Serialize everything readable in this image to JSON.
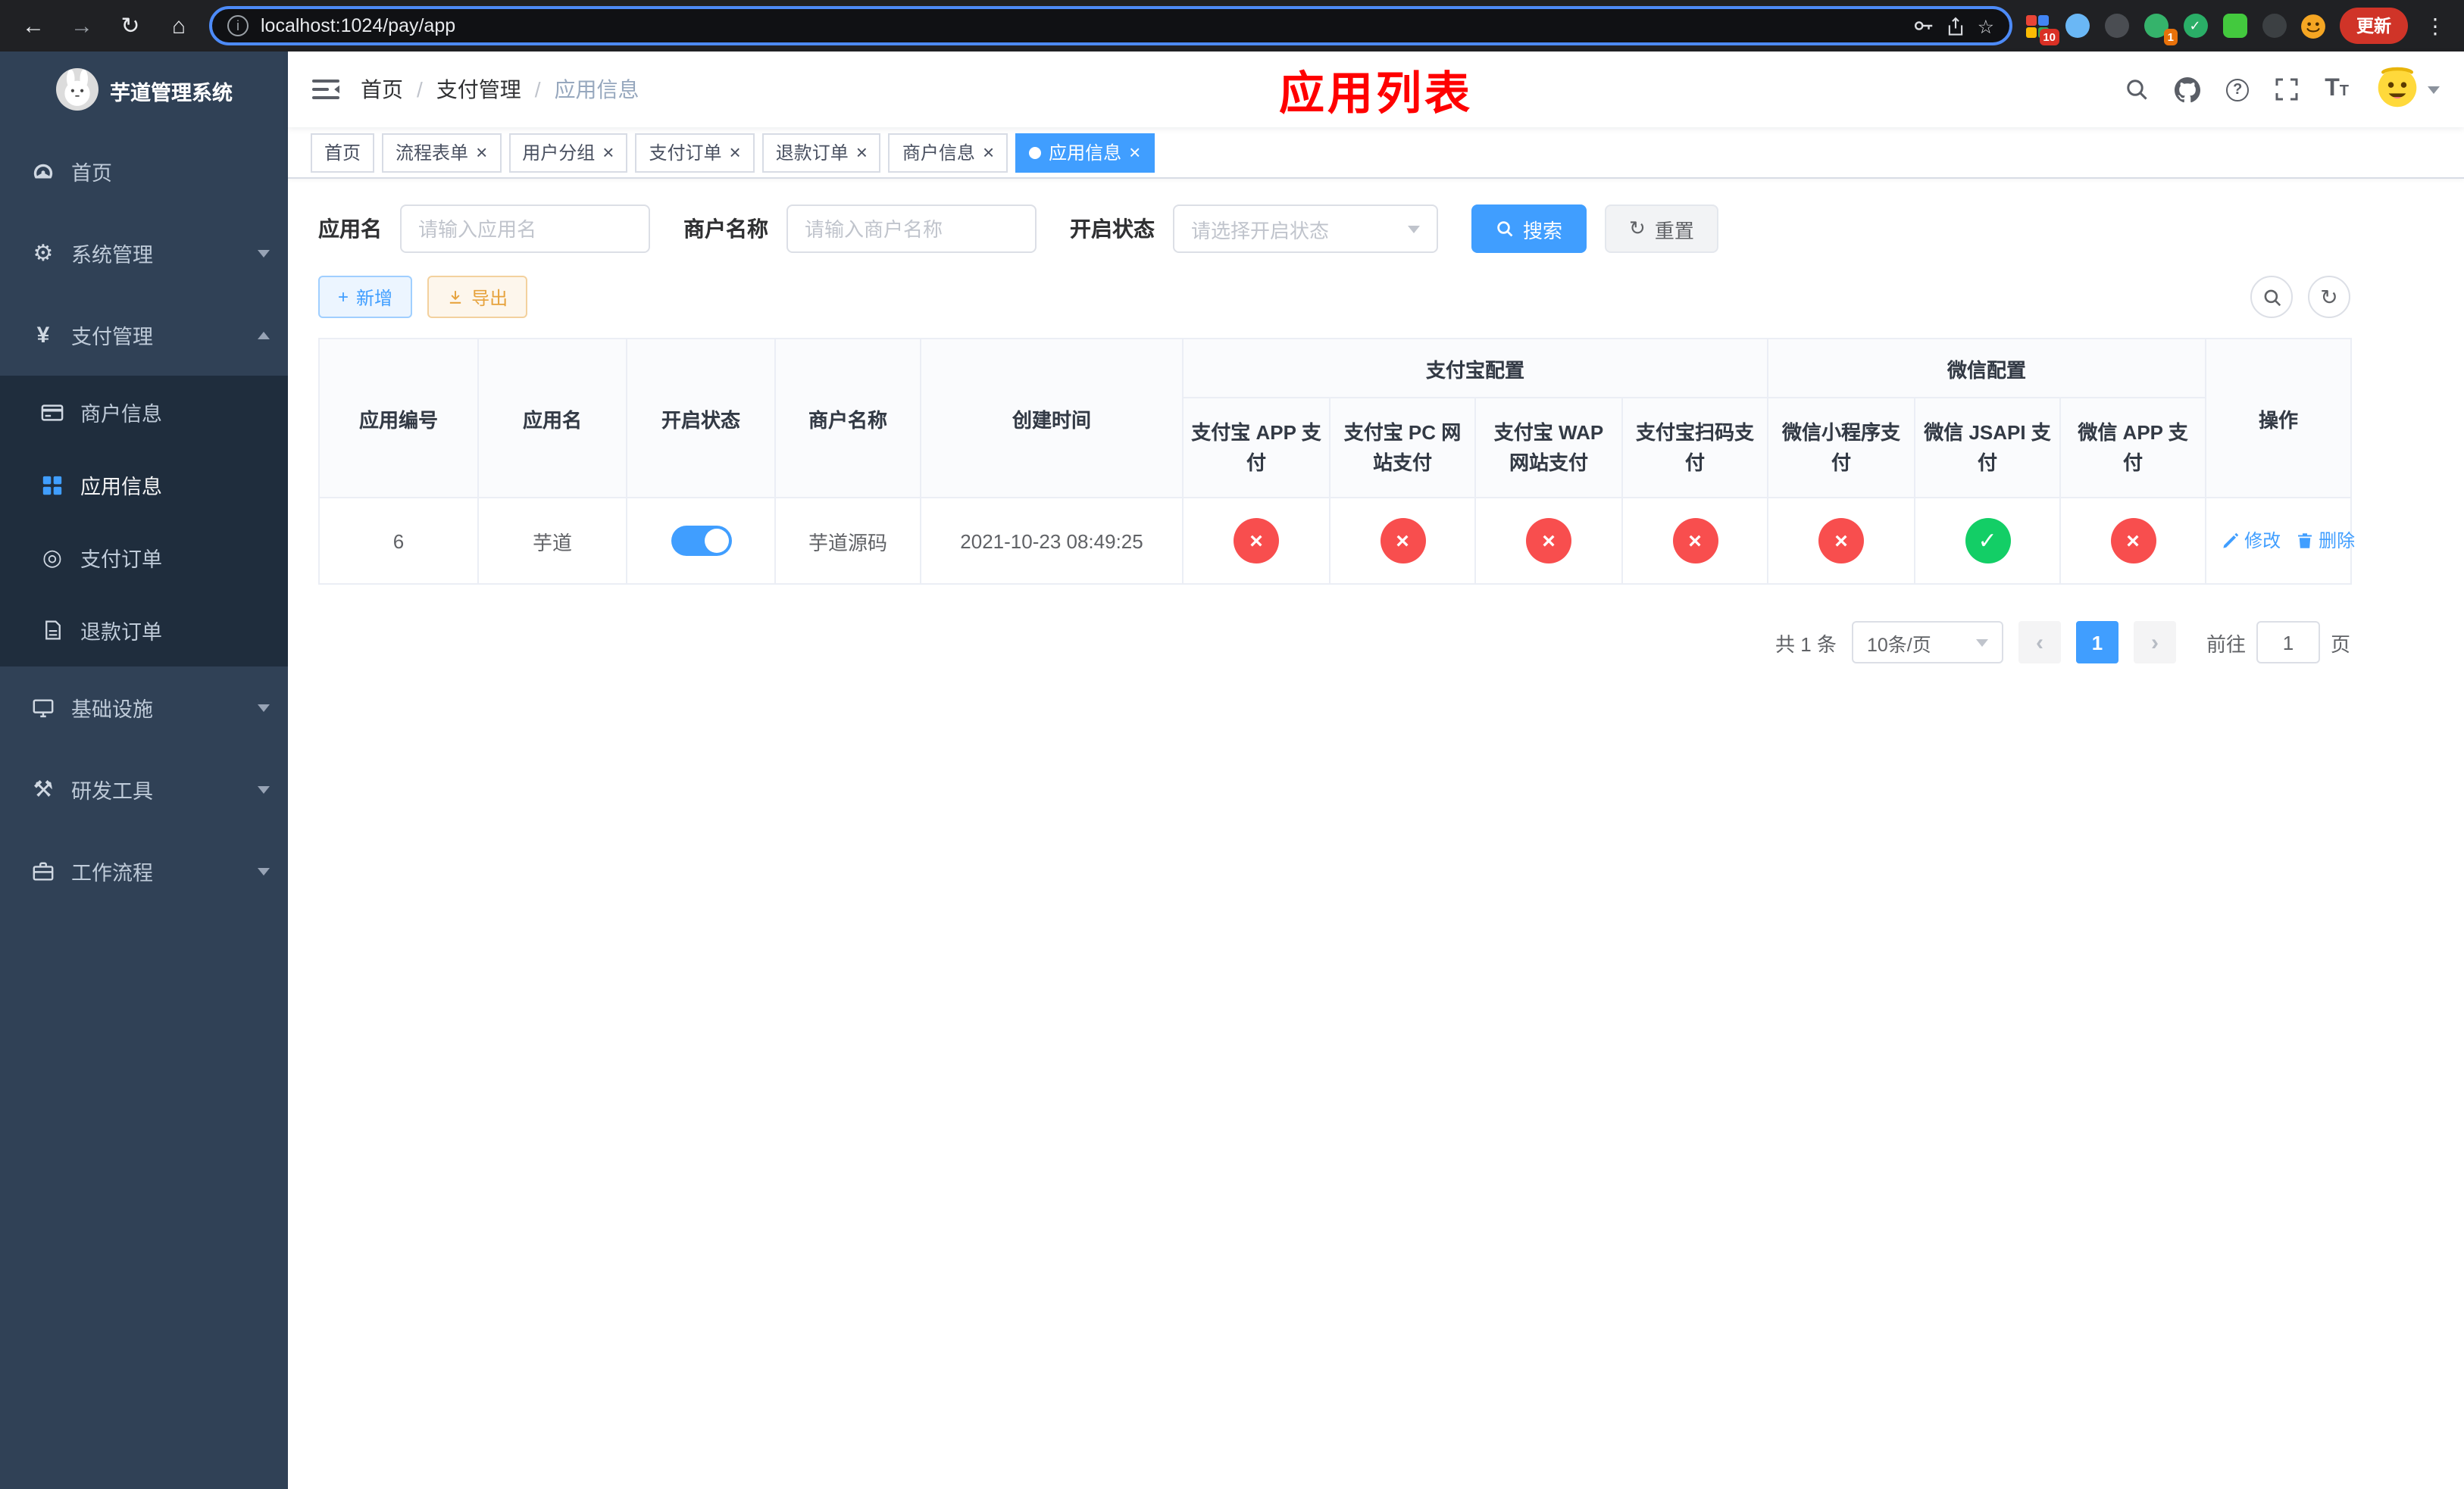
{
  "browser": {
    "back_icon": "←",
    "forward_icon": "→",
    "reload_icon": "↻",
    "home_icon": "⌂",
    "url": "localhost:1024/pay/app",
    "star_icon": "☆",
    "update_button": "更新",
    "menu_dots": "⋮",
    "ext_badge_count": "10",
    "ext_badge_avatar": "1"
  },
  "icons": {
    "close": "×",
    "cross": "×",
    "check": "✓",
    "gear": "⚙",
    "yen": "¥",
    "order": "◎",
    "tools": "⚒",
    "refresh": "↻",
    "prev": "‹",
    "next": "›",
    "slash": "/",
    "question": "?",
    "plus": "+",
    "info": "i",
    "font_big": "T",
    "font_small": "T"
  },
  "sidebar": {
    "logo_title": "芋道管理系统",
    "menu": {
      "home": "首页",
      "system": "系统管理",
      "payment": "支付管理",
      "infra": "基础设施",
      "devtools": "研发工具",
      "workflow": "工作流程"
    },
    "payment_children": {
      "merchant": "商户信息",
      "app": "应用信息",
      "pay_order": "支付订单",
      "refund_order": "退款订单"
    }
  },
  "navbar": {
    "breadcrumb": {
      "home": "首页",
      "section": "支付管理",
      "current": "应用信息"
    },
    "title": "应用列表"
  },
  "tabs": [
    {
      "label": "首页",
      "closable": false,
      "active": false
    },
    {
      "label": "流程表单",
      "closable": true,
      "active": false
    },
    {
      "label": "用户分组",
      "closable": true,
      "active": false
    },
    {
      "label": "支付订单",
      "closable": true,
      "active": false
    },
    {
      "label": "退款订单",
      "closable": true,
      "active": false
    },
    {
      "label": "商户信息",
      "closable": true,
      "active": false
    },
    {
      "label": "应用信息",
      "closable": true,
      "active": true
    }
  ],
  "filters": {
    "app_name_label": "应用名",
    "app_name_placeholder": "请输入应用名",
    "merchant_label": "商户名称",
    "merchant_placeholder": "请输入商户名称",
    "status_label": "开启状态",
    "status_placeholder": "请选择开启状态",
    "search_button": "搜索",
    "reset_button": "重置"
  },
  "toolbar": {
    "add_button": "新增",
    "export_button": "导出"
  },
  "table": {
    "headers": {
      "app_id": "应用编号",
      "app_name": "应用名",
      "status": "开启状态",
      "merchant": "商户名称",
      "create_time": "创建时间",
      "alipay_group": "支付宝配置",
      "wechat_group": "微信配置",
      "alipay_app": "支付宝 APP 支付",
      "alipay_pc": "支付宝 PC 网站支付",
      "alipay_wap": "支付宝 WAP 网站支付",
      "alipay_qr": "支付宝扫码支付",
      "wx_mini": "微信小程序支付",
      "wx_jsapi": "微信 JSAPI 支付",
      "wx_app": "微信 APP 支付",
      "actions": "操作"
    },
    "rows": [
      {
        "app_id": "6",
        "app_name": "芋道",
        "status_enabled": true,
        "merchant": "芋道源码",
        "create_time": "2021-10-23 08:49:25",
        "alipay_app": false,
        "alipay_pc": false,
        "alipay_wap": false,
        "alipay_qr": false,
        "wx_mini": false,
        "wx_jsapi": true,
        "wx_app": false,
        "edit_label": "修改",
        "delete_label": "删除"
      }
    ]
  },
  "pagination": {
    "total": "共 1 条",
    "page_size": "10条/页",
    "page": "1",
    "goto_label": "前往",
    "goto_value": "1",
    "unit": "页"
  },
  "colors": {
    "accent": "#409eff",
    "danger": "#f84e4e",
    "success": "#13ce66",
    "title_red": "#ff0000",
    "sidebar_bg": "#304156",
    "submenu_bg": "#1f2d3d"
  }
}
